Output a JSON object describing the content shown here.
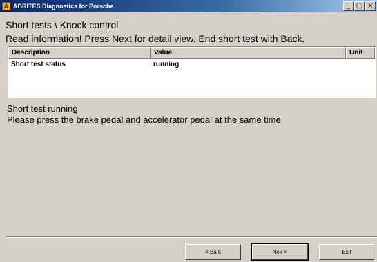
{
  "window": {
    "title": "ABRITES Diagnostics for Porsche",
    "icon_glyph": "A",
    "controls": {
      "minimize": "_",
      "maximize": "□",
      "close": "×"
    }
  },
  "header": {
    "breadcrumb": "Short tests \\ Knock control",
    "instruction": "Read information! Press Next for detail view. End short test with Back."
  },
  "table": {
    "columns": [
      "Description",
      "Value",
      "Unit"
    ],
    "rows": [
      [
        "Short test status",
        "running",
        ""
      ]
    ]
  },
  "message": {
    "line1": "Short test running",
    "line2": "Please press the brake pedal and accelerator pedal at the same time"
  },
  "buttons": {
    "back": "< Ba k",
    "next": "Nex >",
    "exit": "Exit"
  },
  "colors": {
    "titlebar_start": "#0a246a",
    "titlebar_end": "#a6caf0",
    "window_bg": "#d4d0c8",
    "table_bg": "#ffffff"
  }
}
